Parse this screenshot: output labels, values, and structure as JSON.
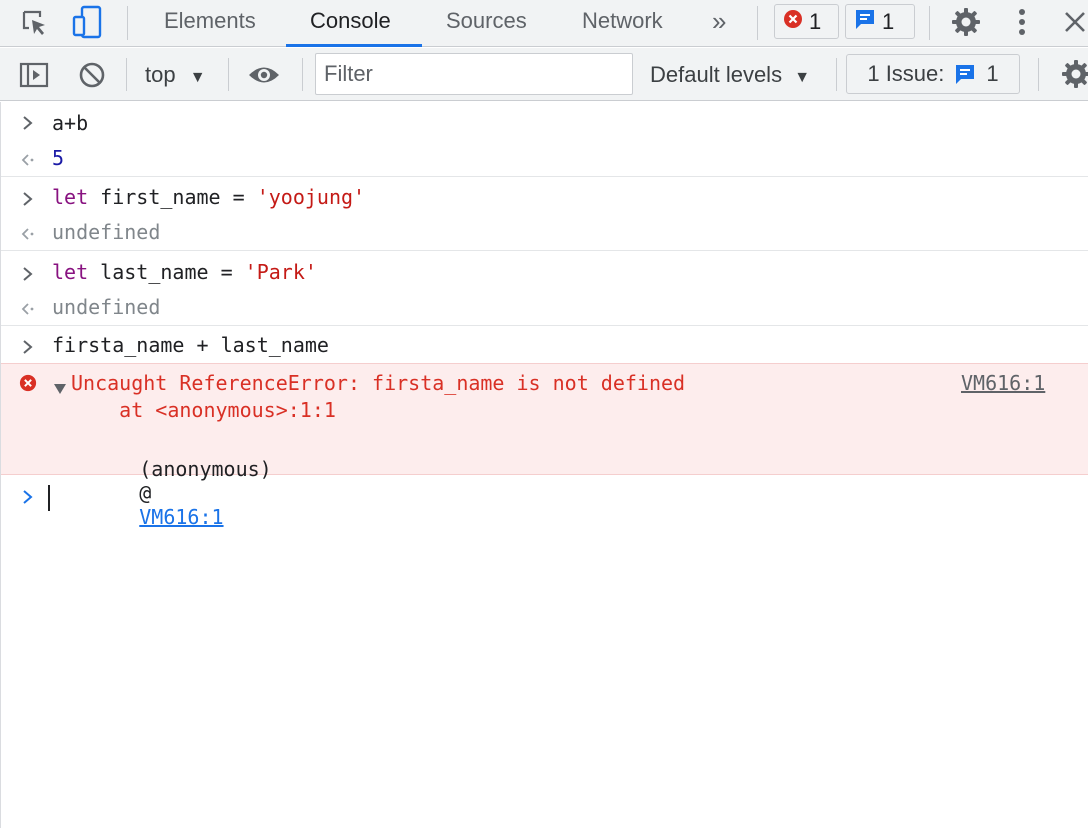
{
  "tabs": [
    {
      "label": "Elements"
    },
    {
      "label": "Console"
    },
    {
      "label": "Sources"
    },
    {
      "label": "Network"
    }
  ],
  "header": {
    "more_tabs_glyph": "»",
    "error_count": "1",
    "message_count": "1"
  },
  "toolbar": {
    "context": "top",
    "filter_placeholder": "Filter",
    "levels": "Default levels",
    "issues_label": "1 Issue:",
    "issues_count": "1"
  },
  "console": {
    "entries": [
      {
        "input": "a+b",
        "output": "5"
      },
      {
        "input_kw": "let",
        "input_rest": " first_name = ",
        "input_str": "'yoojung'",
        "output": "undefined"
      },
      {
        "input_kw": "let",
        "input_rest": " last_name = ",
        "input_str": "'Park'",
        "output": "undefined"
      },
      {
        "input": "firsta_name + last_name"
      }
    ],
    "error": {
      "message": "Uncaught ReferenceError: firsta_name is not defined",
      "stack_line": "    at <anonymous>:1:1",
      "location": "VM616:1",
      "trace_fn": "(anonymous)",
      "trace_at": "@",
      "trace_link": "VM616:1"
    }
  },
  "colors": {
    "accent": "#1a73e8",
    "error": "#d93025",
    "error_bg": "#fdeded",
    "keyword": "#881280",
    "string": "#c41a16",
    "number": "#1a1aa6"
  }
}
